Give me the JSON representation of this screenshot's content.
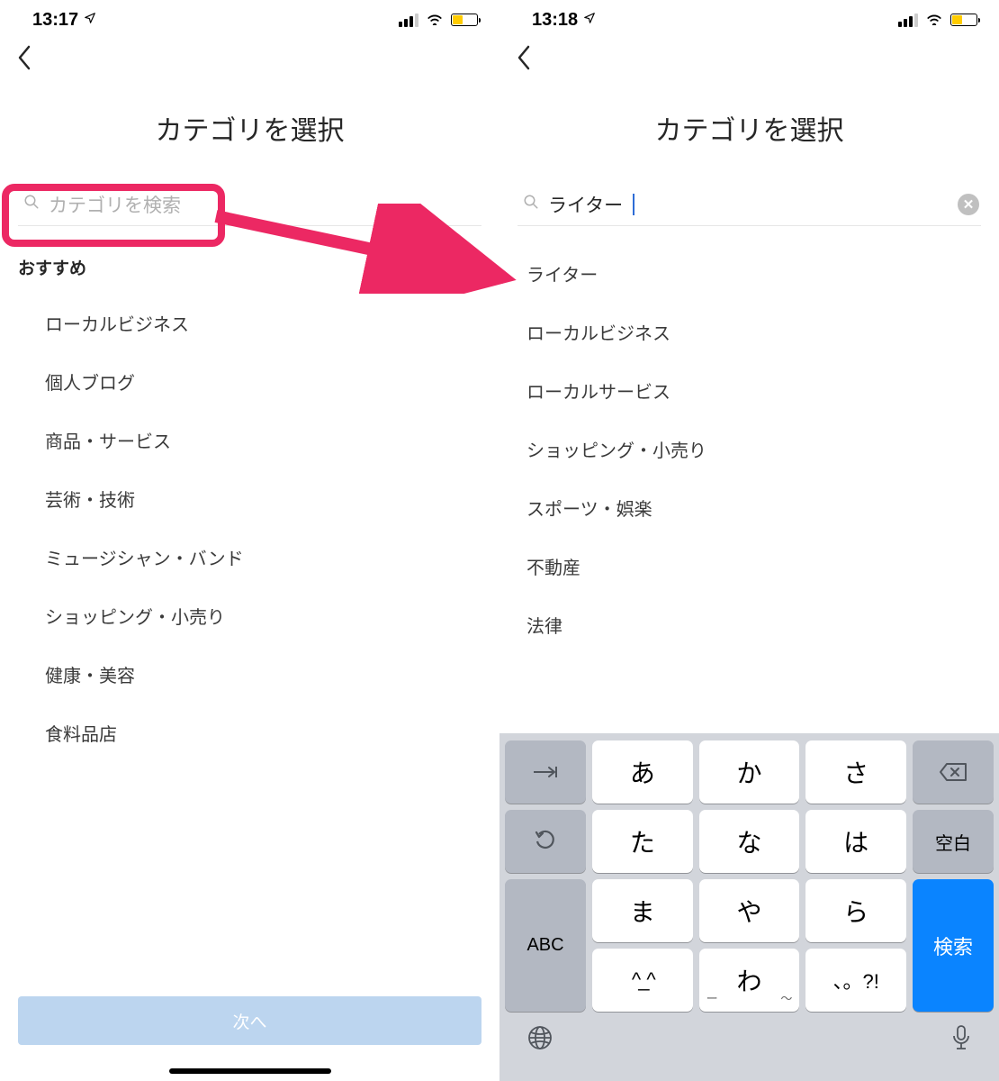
{
  "left": {
    "status_time": "13:17",
    "title": "カテゴリを選択",
    "search_placeholder": "カテゴリを検索",
    "section_label": "おすすめ",
    "categories": [
      "ローカルビジネス",
      "個人ブログ",
      "商品・サービス",
      "芸術・技術",
      "ミュージシャン・バンド",
      "ショッピング・小売り",
      "健康・美容",
      "食料品店"
    ],
    "next_label": "次へ"
  },
  "right": {
    "status_time": "13:18",
    "title": "カテゴリを選択",
    "search_value": "ライター",
    "results": [
      "ライター",
      "ローカルビジネス",
      "ローカルサービス",
      "ショッピング・小売り",
      "スポーツ・娯楽",
      "不動産",
      "法律"
    ]
  },
  "keyboard": {
    "keys_row1": [
      "あ",
      "か",
      "さ"
    ],
    "keys_row2": [
      "た",
      "な",
      "は"
    ],
    "keys_row3": [
      "ま",
      "や",
      "ら"
    ],
    "keys_row4": [
      "^_^",
      "わ",
      "、。?!"
    ],
    "tab": "→",
    "undo": "↺",
    "abc": "ABC",
    "backspace": "⌫",
    "space": "空白",
    "search": "検索",
    "globe": "🌐",
    "mic": "🎤"
  }
}
